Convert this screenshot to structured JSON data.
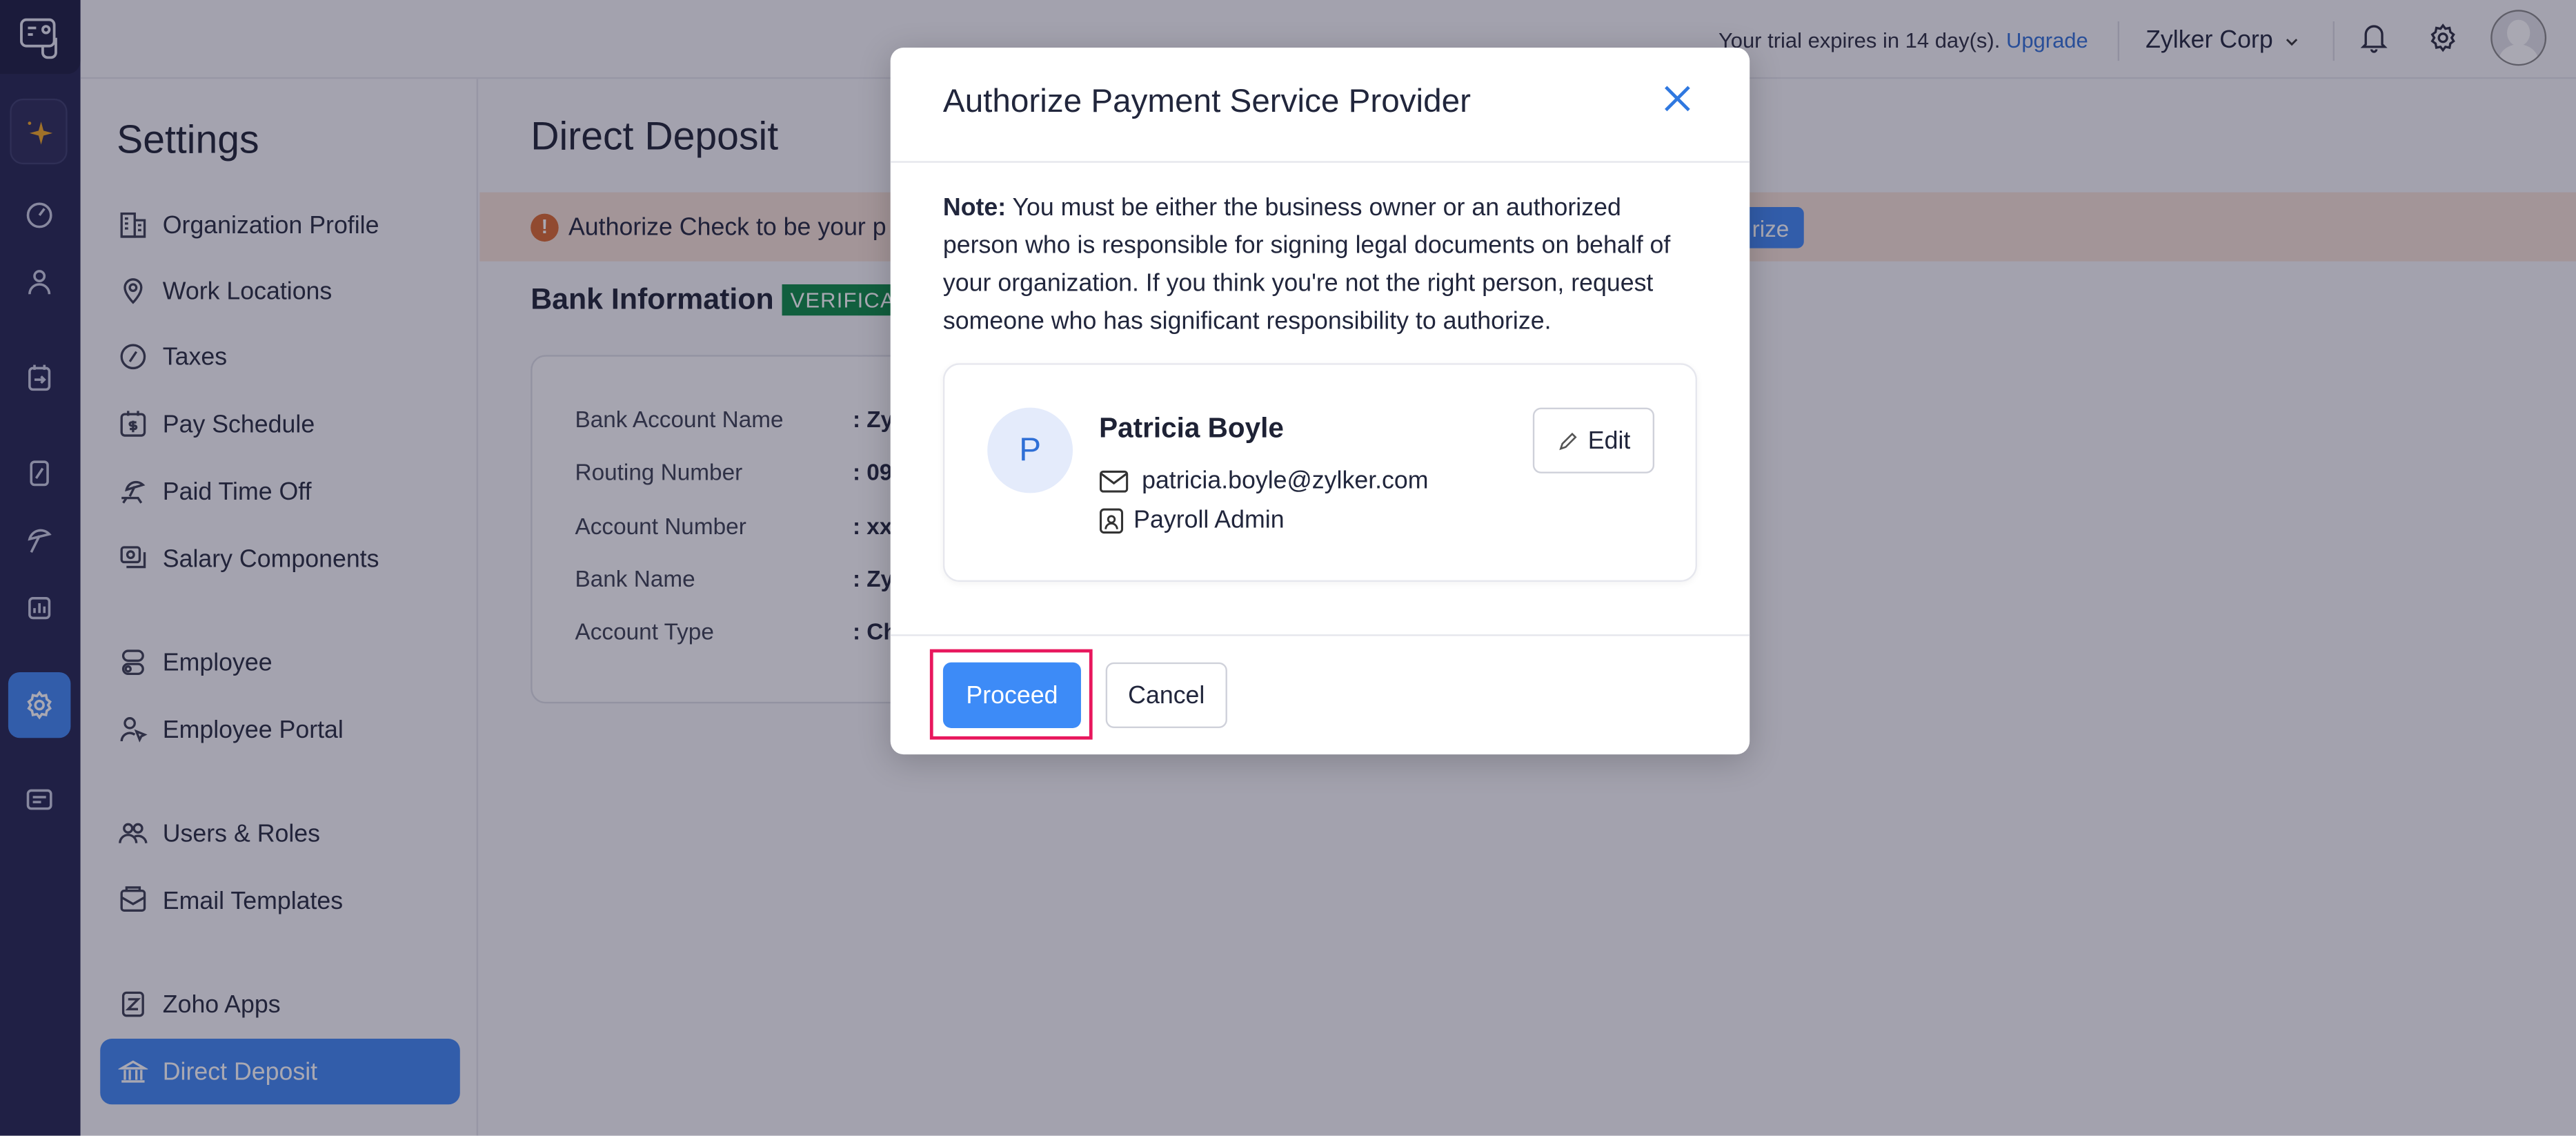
{
  "topbar": {
    "trial_text": "Your trial expires in 14 day(s).",
    "upgrade_link": "Upgrade",
    "org_name": "Zylker Corp"
  },
  "rail": {
    "icons": [
      "app-logo-icon",
      "sparkle-icon",
      "dashboard-icon",
      "employees-icon",
      "pay-run-icon",
      "taxes-icon",
      "benefits-icon",
      "reports-icon",
      "settings-icon",
      "chat-icon"
    ]
  },
  "settings": {
    "title": "Settings",
    "items": [
      {
        "label": "Organization Profile",
        "icon": "building-icon"
      },
      {
        "label": "Work Locations",
        "icon": "location-pin-icon"
      },
      {
        "label": "Taxes",
        "icon": "percent-icon"
      },
      {
        "label": "Pay Schedule",
        "icon": "calendar-dollar-icon"
      },
      {
        "label": "Paid Time Off",
        "icon": "beach-chair-icon"
      },
      {
        "label": "Salary Components",
        "icon": "money-icon"
      },
      {
        "label": "Employee",
        "icon": "toggle-icon"
      },
      {
        "label": "Employee Portal",
        "icon": "user-cursor-icon"
      },
      {
        "label": "Users & Roles",
        "icon": "users-icon"
      },
      {
        "label": "Email Templates",
        "icon": "mail-template-icon"
      },
      {
        "label": "Zoho Apps",
        "icon": "zoho-icon"
      },
      {
        "label": "Direct Deposit",
        "icon": "bank-icon",
        "active": true
      }
    ]
  },
  "main": {
    "title": "Direct Deposit",
    "banner": {
      "text": "Authorize Check to be your p",
      "button": "rize",
      "bg": "#f6e1d6",
      "icon_color": "#d9682e"
    },
    "bank_info": {
      "title": "Bank Information",
      "badge": "VERIFICAT",
      "badge_color": "#0a8a44",
      "rows": [
        {
          "label": "Bank Account Name",
          "value": ": Zy"
        },
        {
          "label": "Routing Number",
          "value": ": 09"
        },
        {
          "label": "Account Number",
          "value": ": xx"
        },
        {
          "label": "Bank Name",
          "value": ": Zy"
        },
        {
          "label": "Account Type",
          "value": ": Ch"
        }
      ]
    }
  },
  "modal": {
    "title": "Authorize Payment Service Provider",
    "note_label": "Note:",
    "note_text": " You must be either the business owner or an authorized person who is responsible for signing legal documents on behalf of your organization. If you think you're not the right person, request someone who has significant responsibility to authorize.",
    "person": {
      "initial": "P",
      "name": "Patricia Boyle",
      "email": "patricia.boyle@zylker.com",
      "role": "Payroll Admin",
      "edit_label": "Edit"
    },
    "proceed_label": "Proceed",
    "cancel_label": "Cancel",
    "colors": {
      "primary": "#3d8bf7",
      "highlight": "#e8175d"
    }
  }
}
